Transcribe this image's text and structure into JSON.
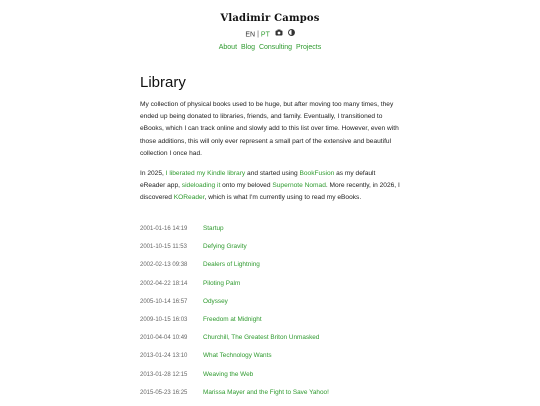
{
  "site": {
    "title": "Vladimir Campos"
  },
  "language": {
    "en": "EN",
    "separator": "|",
    "pt": "PT",
    "camera_icon": "camera-icon",
    "theme_icon": "contrast-toggle-icon"
  },
  "nav": {
    "items": [
      "About",
      "Blog",
      "Consulting",
      "Projects"
    ]
  },
  "page": {
    "heading": "Library",
    "intro": "My collection of physical books used to be huge, but after moving too many times, they ended up being donated to libraries, friends, and family. Eventually, I transitioned to eBooks, which I can track online and slowly add to this list over time. However, even with those additions, this will only ever represent a small part of the extensive and beautiful collection I once had.",
    "para2": {
      "t1": "In 2025, ",
      "link1": "I liberated my Kindle library",
      "t2": " and started using ",
      "link2": "BookFusion",
      "t3": " as my default eReader app, ",
      "link3": "sideloading it",
      "t4": " onto my beloved ",
      "link4": "Supernote Nomad",
      "t5": ". More recently, in 2026, I discovered ",
      "link5": "KOReader",
      "t6": ", which is what I'm currently using to read my eBooks."
    }
  },
  "books": [
    {
      "date": "2001-01-16 14:19",
      "title": "Startup"
    },
    {
      "date": "2001-10-15 11:53",
      "title": "Defying Gravity"
    },
    {
      "date": "2002-02-13 09:38",
      "title": "Dealers of Lightning"
    },
    {
      "date": "2002-04-22 18:14",
      "title": "Piloting Palm"
    },
    {
      "date": "2005-10-14 16:57",
      "title": "Odyssey"
    },
    {
      "date": "2009-10-15 16:03",
      "title": "Freedom at Midnight"
    },
    {
      "date": "2010-04-04 10:49",
      "title": "Churchill, The Greatest Briton Unmasked"
    },
    {
      "date": "2013-01-24 13:10",
      "title": "What Technology Wants"
    },
    {
      "date": "2013-01-28 12:15",
      "title": "Weaving the Web"
    },
    {
      "date": "2015-05-23 16:25",
      "title": "Marissa Mayer and the Fight to Save Yahoo!"
    }
  ],
  "colors": {
    "link": "#2e9a2e",
    "text": "#222222",
    "muted": "#666666"
  }
}
